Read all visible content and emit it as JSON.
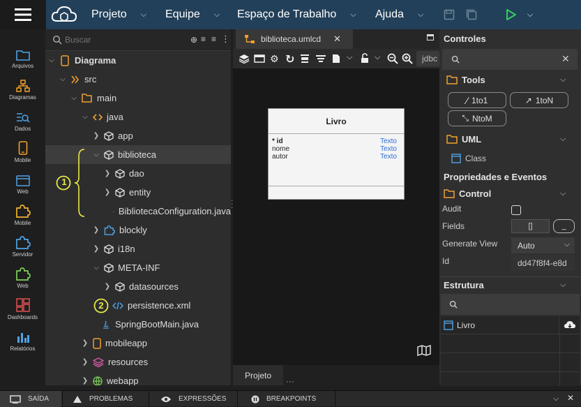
{
  "topbar": {
    "menus": [
      {
        "label": "Projeto"
      },
      {
        "label": "Equipe"
      },
      {
        "label": "Espaço de Trabalho"
      },
      {
        "label": "Ajuda"
      }
    ]
  },
  "rail": [
    {
      "label": "Arquivos",
      "icon": "folder-icon",
      "color": "#4ea3e6"
    },
    {
      "label": "Diagramas",
      "icon": "diagram-icon",
      "color": "#f0a030"
    },
    {
      "label": "Dados",
      "icon": "data-icon",
      "color": "#4ea3e6"
    },
    {
      "label": "Mobile",
      "icon": "mobile-icon",
      "color": "#f0a030"
    },
    {
      "label": "Web",
      "icon": "web-icon",
      "color": "#4ea3e6"
    },
    {
      "label": "Mobile",
      "icon": "puzzle-icon",
      "color": "#f0b030"
    },
    {
      "label": "Servidor",
      "icon": "puzzle-icon",
      "color": "#4ea3e6"
    },
    {
      "label": "Web",
      "icon": "puzzle-icon",
      "color": "#7ed05a"
    },
    {
      "label": "Dashboards",
      "icon": "dashboard-icon",
      "color": "#e05050"
    },
    {
      "label": "Relatórios",
      "icon": "chart-icon",
      "color": "#4ea3e6"
    }
  ],
  "tree": {
    "search_placeholder": "Buscar",
    "items": [
      {
        "label": "Diagrama",
        "bold": true
      },
      {
        "label": "src"
      },
      {
        "label": "main"
      },
      {
        "label": "java"
      },
      {
        "label": "app"
      },
      {
        "label": "biblioteca"
      },
      {
        "label": "dao"
      },
      {
        "label": "entity"
      },
      {
        "label": "BibliotecaConfiguration.java"
      },
      {
        "label": "blockly"
      },
      {
        "label": "i18n"
      },
      {
        "label": "META-INF"
      },
      {
        "label": "datasources"
      },
      {
        "label": "persistence.xml"
      },
      {
        "label": "SpringBootMain.java"
      },
      {
        "label": "mobileapp"
      },
      {
        "label": "resources"
      },
      {
        "label": "webapp"
      }
    ],
    "callouts": [
      "1",
      "2"
    ]
  },
  "editor": {
    "tab_label": "biblioteca.umlcd",
    "datasource_label": "jdbc",
    "uml": {
      "title": "Livro",
      "fields": [
        {
          "name": "* id",
          "type": "Texto"
        },
        {
          "name": "nome",
          "type": "Texto"
        },
        {
          "name": "autor",
          "type": "Texto"
        }
      ]
    },
    "bottom_tab": "Projeto"
  },
  "right": {
    "controles_title": "Controles",
    "tools_title": "Tools",
    "tools": [
      "1to1",
      "1toN",
      "NtoM"
    ],
    "uml_title": "UML",
    "uml_items": [
      "Class"
    ],
    "props_title": "Propriedades e Eventos",
    "control_title": "Control",
    "props": [
      {
        "label": "Audit"
      },
      {
        "label": "Fields",
        "value": "[]",
        "button": "_"
      },
      {
        "label": "Generate View",
        "value": "Auto"
      },
      {
        "label": "Id",
        "value": "dd47f8f4-e8d"
      }
    ],
    "estrutura_title": "Estrutura",
    "estrutura_items": [
      "Livro"
    ]
  },
  "bottom": {
    "tabs": [
      "SAÍDA",
      "PROBLEMAS",
      "EXPRESSÕES",
      "BREAKPOINTS"
    ]
  }
}
